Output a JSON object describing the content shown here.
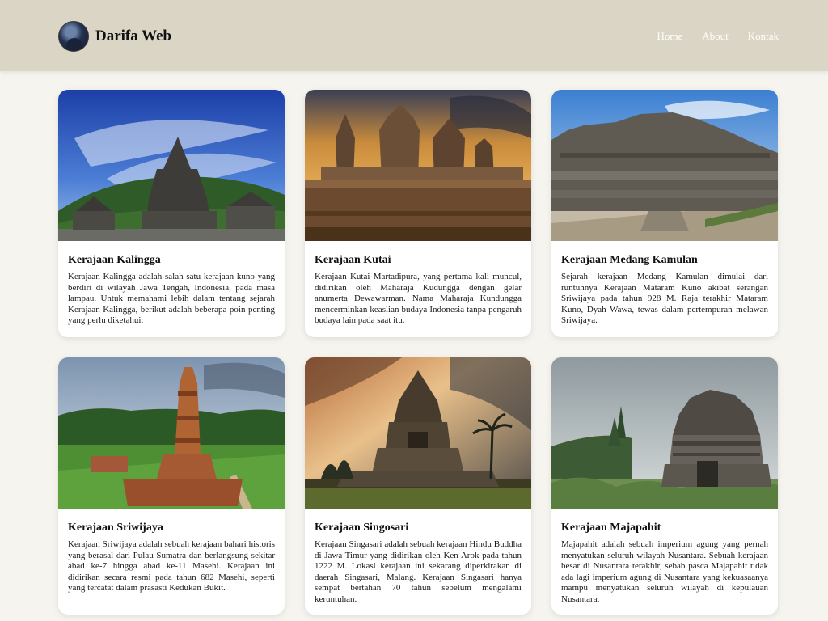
{
  "header": {
    "brand": "Darifa Web",
    "nav": [
      "Home",
      "About",
      "Kontak"
    ]
  },
  "cards": [
    {
      "title": "Kerajaan Kalingga",
      "text": "Kerajaan Kalingga adalah salah satu kerajaan kuno yang berdiri di wilayah Jawa Tengah, Indonesia, pada masa lampau. Untuk memahami lebih dalam tentang sejarah Kerajaan Kalingga, berikut adalah beberapa poin penting yang perlu diketahui:"
    },
    {
      "title": "Kerajaan Kutai",
      "text": "Kerajaan Kutai Martadipura, yang pertama kali muncul, didirikan oleh Maharaja Kudungga dengan gelar anumerta Dewawarman. Nama Maharaja Kundungga mencerminkan keaslian budaya Indonesia tanpa pengaruh budaya lain pada saat itu."
    },
    {
      "title": "Kerajaan Medang Kamulan",
      "text": "Sejarah kerajaan Medang Kamulan dimulai dari runtuhnya Kerajaan Mataram Kuno akibat serangan Sriwijaya pada tahun 928 M. Raja terakhir Mataram Kuno, Dyah Wawa, tewas dalam pertempuran melawan Sriwijaya."
    },
    {
      "title": "Kerajaan Sriwijaya",
      "text": "Kerajaan Sriwijaya adalah sebuah kerajaan bahari historis yang berasal dari Pulau Sumatra dan berlangsung sekitar abad ke-7 hingga abad ke-11 Masehi. Kerajaan ini didirikan secara resmi pada tahun 682 Masehi, seperti yang tercatat dalam prasasti Kedukan Bukit."
    },
    {
      "title": "Kerajaan Singosari",
      "text": "Kerajaan Singasari adalah sebuah kerajaan Hindu Buddha di Jawa Timur yang didirikan oleh Ken Arok pada tahun 1222 M. Lokasi kerajaan ini sekarang diperkirakan di daerah Singasari, Malang. Kerajaan Singasari hanya sempat bertahan 70 tahun sebelum mengalami keruntuhan."
    },
    {
      "title": "Kerajaan Majapahit",
      "text": "Majapahit adalah sebuah imperium agung yang pernah menyatukan seluruh wilayah Nusantara. Sebuah kerajaan besar di Nusantara terakhir, sebab pasca Majapahit tidak ada lagi imperium agung di Nusantara yang kekuasaanya mampu menyatukan seluruh wilayah di kepulauan Nusantara."
    }
  ]
}
